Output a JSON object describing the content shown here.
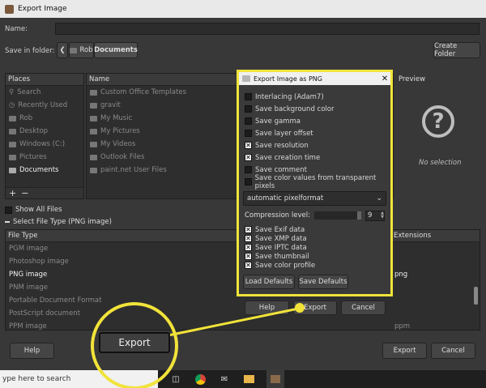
{
  "window": {
    "title": "Export Image"
  },
  "name_row": {
    "label": "Name:",
    "value": ""
  },
  "folder_row": {
    "label": "Save in folder:",
    "crumbs": [
      "Rob",
      "Documents"
    ],
    "create_folder": "Create Folder"
  },
  "places": {
    "header": "Places",
    "items": [
      "Search",
      "Recently Used",
      "Rob",
      "Desktop",
      "Windows (C:)",
      "Pictures",
      "Documents"
    ],
    "add": "+",
    "remove": "−"
  },
  "files": {
    "header": "Name",
    "items": [
      "Custom Office Templates",
      "gravit",
      "My Music",
      "My Pictures",
      "My Videos",
      "Outlook Files",
      "paint.net User Files"
    ]
  },
  "preview": {
    "header": "Preview",
    "icon": "question-icon",
    "text": "No selection"
  },
  "show_all": "Show All Files",
  "select_type": "Select File Type (PNG image)",
  "type_table": {
    "col1": "File Type",
    "col2": "Extensions",
    "rows": [
      {
        "type": "PGM image",
        "ext": ""
      },
      {
        "type": "Photoshop image",
        "ext": ""
      },
      {
        "type": "PNG image",
        "ext": "png"
      },
      {
        "type": "PNM image",
        "ext": ""
      },
      {
        "type": "Portable Document Format",
        "ext": ""
      },
      {
        "type": "PostScript document",
        "ext": ""
      },
      {
        "type": "PPM image",
        "ext": "ppm"
      }
    ]
  },
  "bottom": {
    "help": "Help",
    "export": "Export",
    "cancel": "Cancel"
  },
  "dialog": {
    "title": "Export Image as PNG",
    "options": [
      {
        "label": "Interlacing (Adam7)",
        "checked": false
      },
      {
        "label": "Save background color",
        "checked": false
      },
      {
        "label": "Save gamma",
        "checked": false
      },
      {
        "label": "Save layer offset",
        "checked": false
      },
      {
        "label": "Save resolution",
        "checked": true
      },
      {
        "label": "Save creation time",
        "checked": true
      },
      {
        "label": "Save comment",
        "checked": false
      },
      {
        "label": "Save color values from transparent pixels",
        "checked": false
      }
    ],
    "pixelformat": "automatic pixelformat",
    "compression_label": "Compression level:",
    "compression_value": "9",
    "meta": [
      {
        "label": "Save Exif data",
        "checked": true
      },
      {
        "label": "Save XMP data",
        "checked": true
      },
      {
        "label": "Save IPTC data",
        "checked": true
      },
      {
        "label": "Save thumbnail",
        "checked": true
      },
      {
        "label": "Save color profile",
        "checked": true
      }
    ],
    "load_defaults": "Load Defaults",
    "save_defaults": "Save Defaults",
    "help": "Help",
    "export": "Export",
    "cancel": "Cancel"
  },
  "callout": {
    "label": "Export"
  },
  "taskbar": {
    "search": "ype here to search"
  },
  "colors": {
    "highlight": "#f1e33a",
    "background": "#383838"
  }
}
